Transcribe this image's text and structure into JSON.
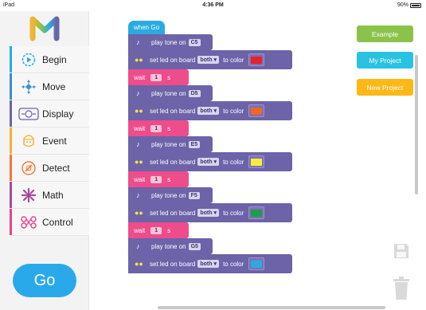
{
  "status_bar": {
    "device": "iPad",
    "time": "4:36 PM",
    "battery": "90%"
  },
  "sidebar": {
    "items": [
      {
        "label": "Begin",
        "color": "#29abe2",
        "icon": "play-circle-icon"
      },
      {
        "label": "Move",
        "color": "#3a8ed1",
        "icon": "move-arrows-icon"
      },
      {
        "label": "Display",
        "color": "#6c63a8",
        "icon": "display-icon"
      },
      {
        "label": "Event",
        "color": "#f7b233",
        "icon": "event-icon"
      },
      {
        "label": "Detect",
        "color": "#f27a36",
        "icon": "detect-icon"
      },
      {
        "label": "Math",
        "color": "#a54aa0",
        "icon": "math-icon"
      },
      {
        "label": "Control",
        "color": "#e8438a",
        "icon": "control-icon"
      }
    ],
    "go_label": "Go"
  },
  "program": {
    "hat": "when Go",
    "tone_prefix": "play tone on",
    "led_prefix": "set led on board",
    "led_target": "both",
    "led_mid": "to color",
    "wait_label": "wait",
    "wait_unit": "s",
    "steps": [
      {
        "note": "C5",
        "color": "#e8202a",
        "wait": "1"
      },
      {
        "note": "D5",
        "color": "#f26522",
        "wait": "1"
      },
      {
        "note": "E5",
        "color": "#f7ec3c",
        "wait": "1"
      },
      {
        "note": "F5",
        "color": "#1e9e48",
        "wait": "1"
      },
      {
        "note": "G5",
        "color": "#29abe2"
      }
    ]
  },
  "buttons": {
    "example": "Example",
    "my_project": "My Project",
    "new_project": "New Project"
  },
  "colors": {
    "example": "#8bc34a",
    "my_project": "#29c3e2",
    "new_project": "#fbb817"
  }
}
